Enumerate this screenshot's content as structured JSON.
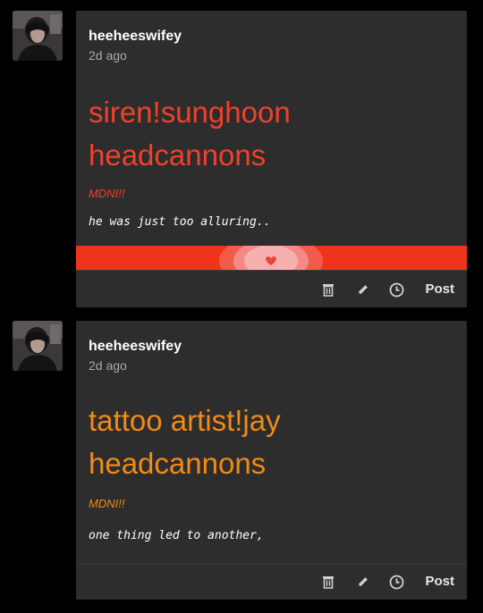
{
  "colors": {
    "page_bg": "#000000",
    "card_bg": "#2d2d2d",
    "username": "#ffffff",
    "timestamp": "#a9a9a9",
    "accent_red": "#f2402a",
    "accent_orange": "#f28a14"
  },
  "posts": [
    {
      "username": "heeheeswifey",
      "timestamp": "2d ago",
      "title_line1": "siren!sunghoon",
      "title_line2": "headcannons",
      "warning": "MDNI!!",
      "excerpt": "he was just too alluring..",
      "accent": "#f2402a",
      "actions": {
        "delete_icon": "trash-icon",
        "edit_icon": "pencil-icon",
        "schedule_icon": "clock-icon",
        "post_label": "Post"
      }
    },
    {
      "username": "heeheeswifey",
      "timestamp": "2d ago",
      "title_line1": "tattoo artist!jay",
      "title_line2": "headcannons",
      "warning": "MDNI!!",
      "excerpt": "one thing led to another,",
      "accent": "#f28a14",
      "actions": {
        "delete_icon": "trash-icon",
        "edit_icon": "pencil-icon",
        "schedule_icon": "clock-icon",
        "post_label": "Post"
      }
    }
  ]
}
